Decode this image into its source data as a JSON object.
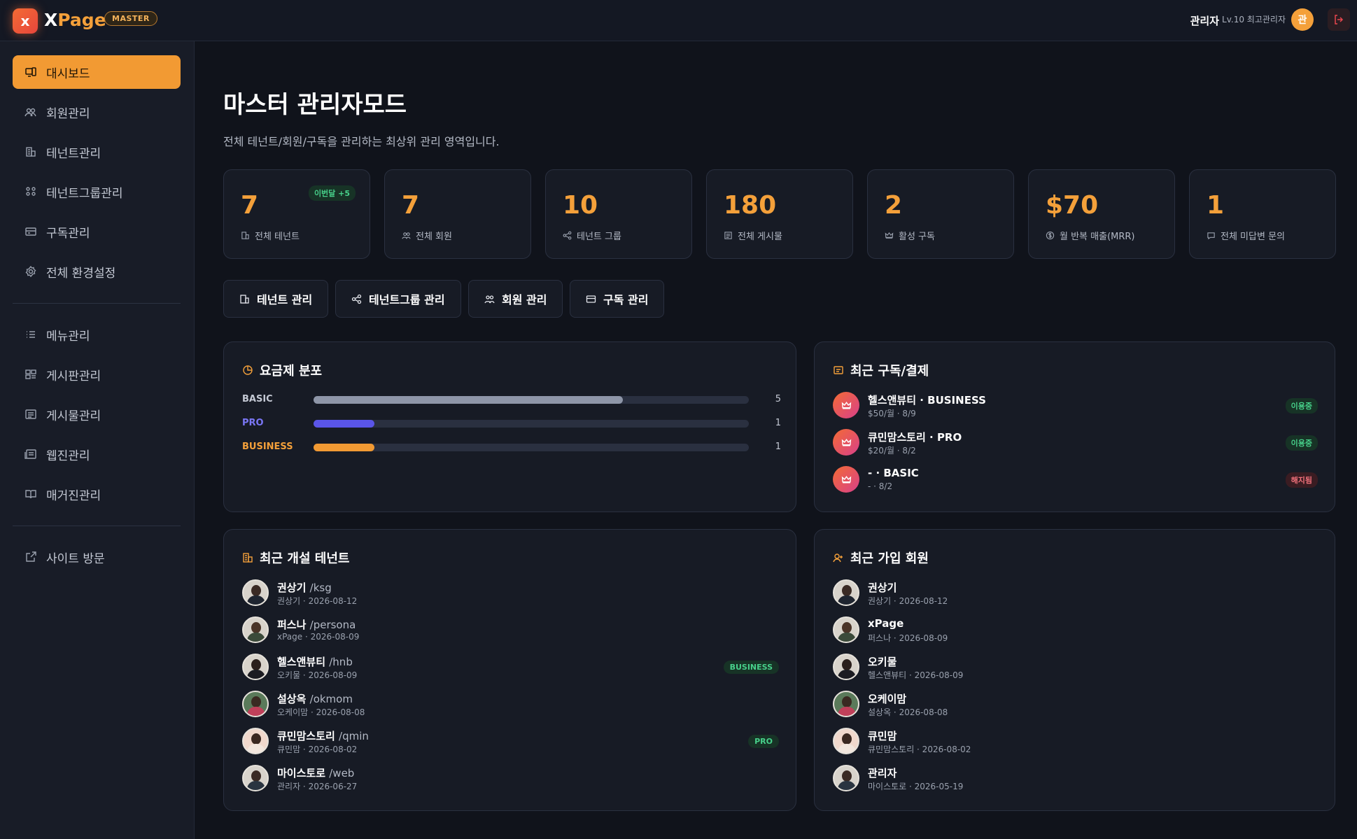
{
  "brand": {
    "logo_letter": "x",
    "name_x": "X",
    "name_rest": "Page",
    "badge": "MASTER"
  },
  "header": {
    "user_name": "관리자",
    "user_level": "Lv.10 최고관리자",
    "avatar_letter": "관"
  },
  "sidebar": {
    "items": [
      {
        "label": "대시보드",
        "icon": "dashboard-icon",
        "active": true
      },
      {
        "label": "회원관리",
        "icon": "users-icon"
      },
      {
        "label": "테넌트관리",
        "icon": "building-icon"
      },
      {
        "label": "테넌트그룹관리",
        "icon": "group-icon"
      },
      {
        "label": "구독관리",
        "icon": "card-icon"
      },
      {
        "label": "전체 환경설정",
        "icon": "gear-icon"
      },
      {
        "label": "메뉴관리",
        "icon": "list-icon"
      },
      {
        "label": "게시판관리",
        "icon": "board-icon"
      },
      {
        "label": "게시물관리",
        "icon": "post-icon"
      },
      {
        "label": "웹진관리",
        "icon": "webzine-icon"
      },
      {
        "label": "매거진관리",
        "icon": "book-icon"
      },
      {
        "label": "사이트 방문",
        "icon": "external-link-icon"
      }
    ]
  },
  "main": {
    "title": "마스터 관리자모드",
    "subtitle": "전체 테넌트/회원/구독을 관리하는 최상위 관리 영역입니다.",
    "stats": [
      {
        "value": "7",
        "label": "전체 테넌트",
        "badge": "이번달 +5"
      },
      {
        "value": "7",
        "label": "전체 회원"
      },
      {
        "value": "10",
        "label": "테넌트 그룹"
      },
      {
        "value": "180",
        "label": "전체 게시물"
      },
      {
        "value": "2",
        "label": "활성 구독"
      },
      {
        "value": "$70",
        "label": "월 반복 매출(MRR)"
      },
      {
        "value": "1",
        "label": "전체 미답변 문의"
      }
    ],
    "quick_buttons": [
      "테넌트 관리",
      "테넌트그룹 관리",
      "회원 관리",
      "구독 관리"
    ],
    "plan_distribution": {
      "title": "요금제 분포",
      "rows": [
        {
          "label": "BASIC",
          "count": "5",
          "fraction": 0.71,
          "color": "#8e96a8"
        },
        {
          "label": "PRO",
          "count": "1",
          "fraction": 0.14,
          "color": "#5a55e8"
        },
        {
          "label": "BUSINESS",
          "count": "1",
          "fraction": 0.14,
          "color": "#f29a33"
        }
      ]
    },
    "recent_subscriptions": {
      "title": "최근 구독/결제",
      "rows": [
        {
          "name": "헬스앤뷰티 · BUSINESS",
          "meta": "$50/월 · 8/9",
          "status": "이용중"
        },
        {
          "name": "큐민맘스토리 · PRO",
          "meta": "$20/월 · 8/2",
          "status": "이용중"
        },
        {
          "name": "- · BASIC",
          "meta": "- · 8/2",
          "status": "해지됨"
        }
      ]
    },
    "recent_tenants": {
      "title": "최근 개설 테넌트",
      "rows": [
        {
          "name": "권상기",
          "slug": "/ksg",
          "meta": "권상기 · 2026-08-12",
          "plan": ""
        },
        {
          "name": "퍼스나",
          "slug": "/persona",
          "meta": "xPage · 2026-08-09",
          "plan": ""
        },
        {
          "name": "헬스앤뷰티",
          "slug": "/hnb",
          "meta": "오키물 · 2026-08-09",
          "plan": "BUSINESS"
        },
        {
          "name": "설상옥",
          "slug": "/okmom",
          "meta": "오케이맘 · 2026-08-08",
          "plan": ""
        },
        {
          "name": "큐민맘스토리",
          "slug": "/qmin",
          "meta": "큐민맘 · 2026-08-02",
          "plan": "PRO"
        },
        {
          "name": "마이스토로",
          "slug": "/web",
          "meta": "관리자 · 2026-06-27",
          "plan": ""
        }
      ]
    },
    "recent_members": {
      "title": "최근 가입 회원",
      "rows": [
        {
          "name": "권상기",
          "meta": "권상기 · 2026-08-12"
        },
        {
          "name": "xPage",
          "meta": "퍼스나 · 2026-08-09"
        },
        {
          "name": "오키물",
          "meta": "헬스앤뷰티 · 2026-08-09"
        },
        {
          "name": "오케이맘",
          "meta": "설상옥 · 2026-08-08"
        },
        {
          "name": "큐민맘",
          "meta": "큐민맘스토리 · 2026-08-02"
        },
        {
          "name": "관리자",
          "meta": "마이스토로 · 2026-05-19"
        }
      ]
    }
  }
}
